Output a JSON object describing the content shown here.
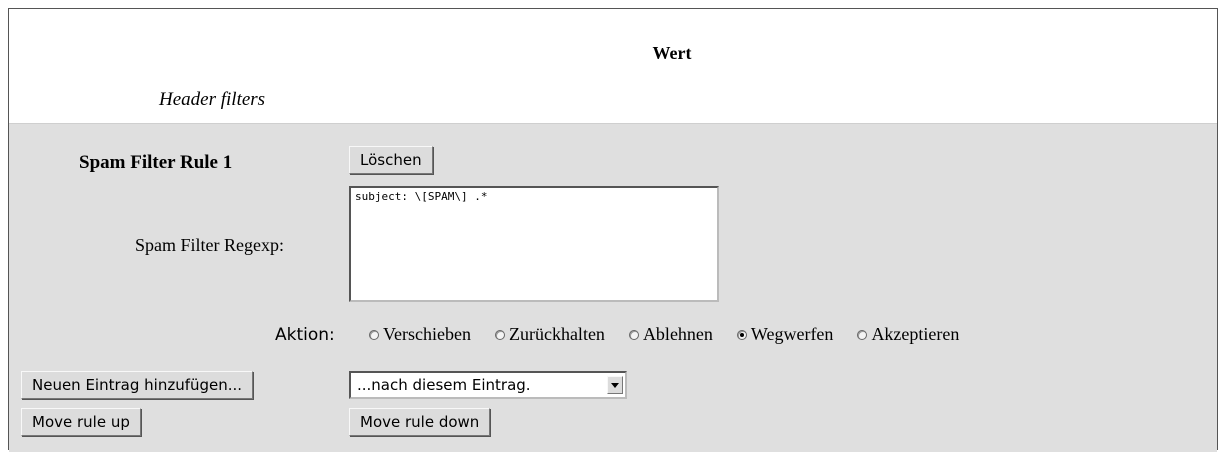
{
  "table": {
    "column_header": "Wert",
    "section_title": "Header filters"
  },
  "rule": {
    "title": "Spam Filter Rule 1",
    "delete_label": "Löschen",
    "regexp_label": "Spam Filter Regexp:",
    "regexp_value": "subject: \\[SPAM\\] .*",
    "action_label": "Aktion:",
    "actions": [
      {
        "label": "Verschieben",
        "checked": false
      },
      {
        "label": "Zurückhalten",
        "checked": false
      },
      {
        "label": "Ablehnen",
        "checked": false
      },
      {
        "label": "Wegwerfen",
        "checked": true
      },
      {
        "label": "Akzeptieren",
        "checked": false
      }
    ]
  },
  "controls": {
    "add_entry_label": "Neuen Eintrag hinzufügen...",
    "position_select": "...nach diesem Eintrag.",
    "move_up_label": "Move rule up",
    "move_down_label": "Move rule down"
  }
}
